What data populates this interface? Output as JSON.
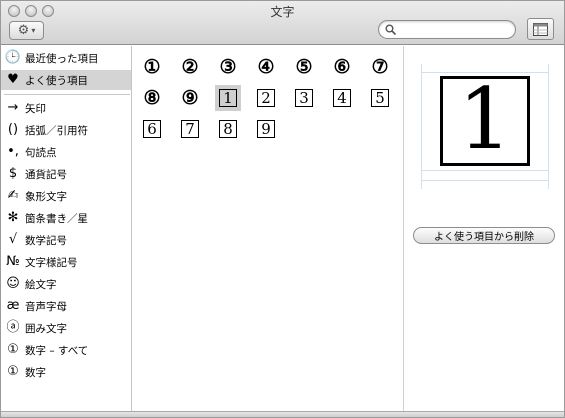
{
  "window": {
    "title": "文字"
  },
  "search": {
    "placeholder": "",
    "value": ""
  },
  "sidebar": {
    "top_items": [
      {
        "label": "最近使った項目",
        "icon": "clock-icon",
        "glyph": "🕒"
      },
      {
        "label": "よく使う項目",
        "icon": "heart-icon",
        "glyph": "♥",
        "selected": true
      }
    ],
    "items": [
      {
        "label": "矢印",
        "icon": "arrow-icon",
        "glyph": "→"
      },
      {
        "label": "括弧／引用符",
        "icon": "parentheses-icon",
        "glyph": "()"
      },
      {
        "label": "句読点",
        "icon": "punctuation-icon",
        "glyph": "•,"
      },
      {
        "label": "通貨記号",
        "icon": "dollar-icon",
        "glyph": "$"
      },
      {
        "label": "象形文字",
        "icon": "pictograph-icon",
        "glyph": "✍"
      },
      {
        "label": "箇条書き／星",
        "icon": "asterisk-icon",
        "glyph": "✻"
      },
      {
        "label": "数学記号",
        "icon": "square-root-icon",
        "glyph": "√"
      },
      {
        "label": "文字様記号",
        "icon": "numero-icon",
        "glyph": "№"
      },
      {
        "label": "絵文字",
        "icon": "smiley-icon",
        "glyph": "☺"
      },
      {
        "label": "音声字母",
        "icon": "ae-ligature-icon",
        "glyph": "æ"
      },
      {
        "label": "囲み文字",
        "icon": "circled-a-icon",
        "glyph": "ⓐ"
      },
      {
        "label": "数字 – すべて",
        "icon": "circled-one-icon",
        "glyph": "①"
      },
      {
        "label": "数字",
        "icon": "circled-one-icon",
        "glyph": "①"
      }
    ]
  },
  "characters": [
    {
      "char": "①",
      "style": "circled"
    },
    {
      "char": "②",
      "style": "circled"
    },
    {
      "char": "③",
      "style": "circled"
    },
    {
      "char": "④",
      "style": "circled"
    },
    {
      "char": "⑤",
      "style": "circled"
    },
    {
      "char": "⑥",
      "style": "circled"
    },
    {
      "char": "⑦",
      "style": "circled"
    },
    {
      "char": "⑧",
      "style": "circled"
    },
    {
      "char": "⑨",
      "style": "circled"
    },
    {
      "char": "1",
      "style": "boxed",
      "selected": true
    },
    {
      "char": "2",
      "style": "boxed"
    },
    {
      "char": "3",
      "style": "boxed"
    },
    {
      "char": "4",
      "style": "boxed"
    },
    {
      "char": "5",
      "style": "boxed"
    },
    {
      "char": "6",
      "style": "boxed"
    },
    {
      "char": "7",
      "style": "boxed"
    },
    {
      "char": "8",
      "style": "boxed"
    },
    {
      "char": "9",
      "style": "boxed"
    }
  ],
  "preview": {
    "char": "1",
    "remove_button_label": "よく使う項目から削除"
  },
  "colors": {
    "selection": "#d4d4d4",
    "guide_lines": "#cfe0ee"
  }
}
